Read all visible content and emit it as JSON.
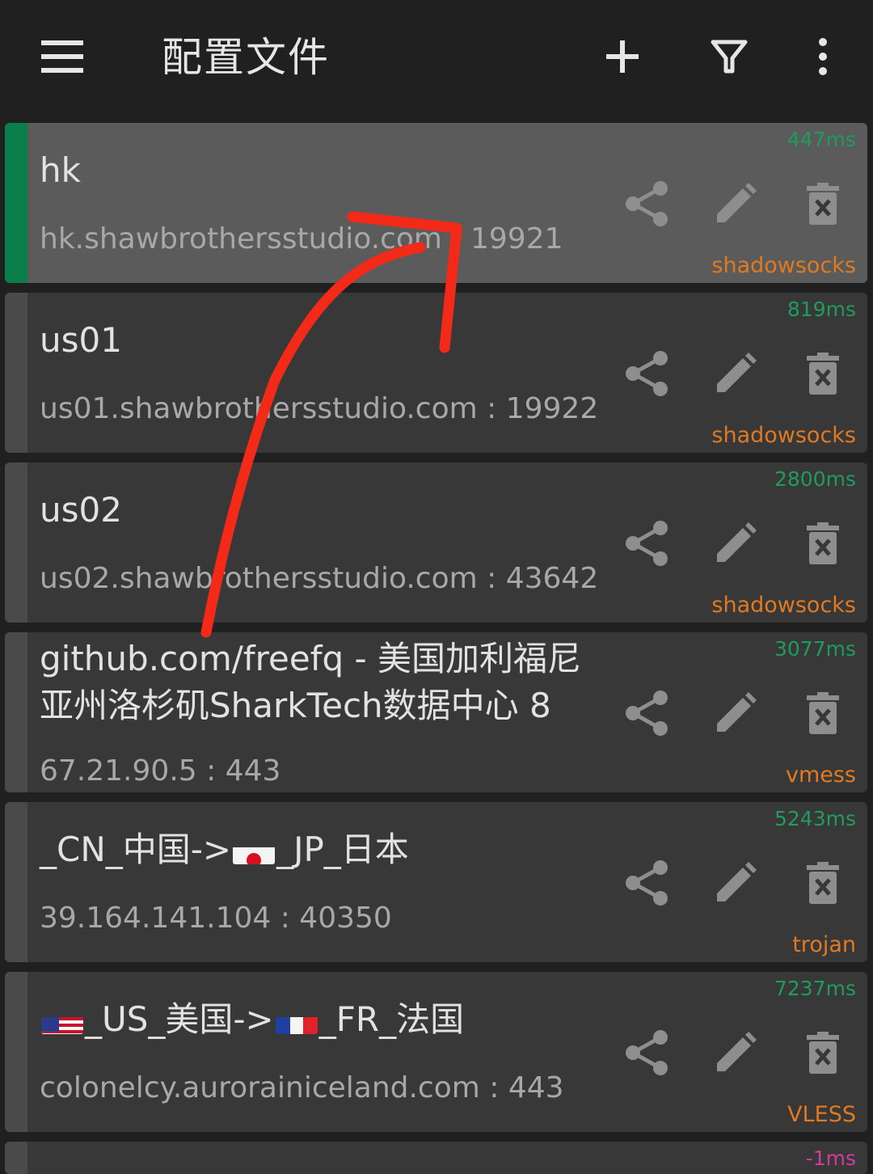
{
  "toolbar": {
    "title": "配置文件",
    "menu_icon": "hamburger-menu-icon",
    "add_icon": "plus-icon",
    "filter_icon": "filter-icon",
    "more_icon": "more-vert-icon"
  },
  "colors": {
    "selected_indicator": "#0a7e4a",
    "latency": "#1f9b5c",
    "latency_fail": "#d13c9a",
    "protocol": "#e07a22",
    "annotation_arrow": "#f22a17"
  },
  "servers": [
    {
      "name": "hk",
      "address": "hk.shawbrothersstudio.com : 19921",
      "latency": "447ms",
      "type": "shadowsocks",
      "selected": true
    },
    {
      "name": "us01",
      "address": "us01.shawbrothersstudio.com : 19922",
      "latency": "819ms",
      "type": "shadowsocks"
    },
    {
      "name": "us02",
      "address": "us02.shawbrothersstudio.com : 43642",
      "latency": "2800ms",
      "type": "shadowsocks"
    },
    {
      "name": "github.com/freefq - 美国加利福尼亚州洛杉矶SharkTech数据中心 8",
      "address": "67.21.90.5 : 443",
      "latency": "3077ms",
      "type": "vmess"
    },
    {
      "name_parts": [
        "_CN_中国->",
        "_JP_日本"
      ],
      "address": "39.164.141.104 : 40350",
      "latency": "5243ms",
      "type": "trojan"
    },
    {
      "name_parts": [
        "_US_美国->",
        "_FR_法国"
      ],
      "address": "colonelcy.aurorainiceland.com : 443",
      "latency": "7237ms",
      "type": "VLESS"
    },
    {
      "latency": "-1ms"
    }
  ]
}
